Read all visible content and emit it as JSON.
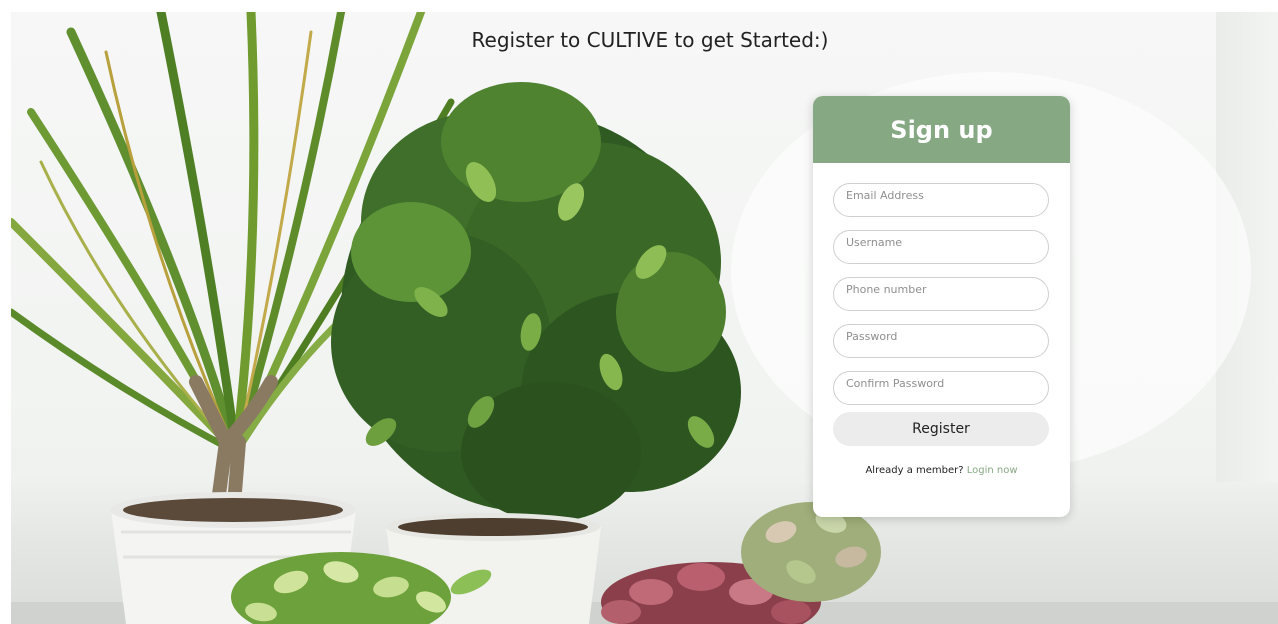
{
  "page": {
    "title": "Register to CULTIVE to get Started:)"
  },
  "signup": {
    "heading": "Sign up",
    "fields": {
      "email_placeholder": "Email Address",
      "username_placeholder": "Username",
      "phone_placeholder": "Phone number",
      "password_placeholder": "Password",
      "confirm_password_placeholder": "Confirm Password"
    },
    "register_label": "Register",
    "member_prompt": "Already a member?",
    "login_label": "Login now"
  },
  "colors": {
    "accent": "#86a883",
    "button_bg": "#ececec",
    "field_border": "#cfcfcf"
  }
}
